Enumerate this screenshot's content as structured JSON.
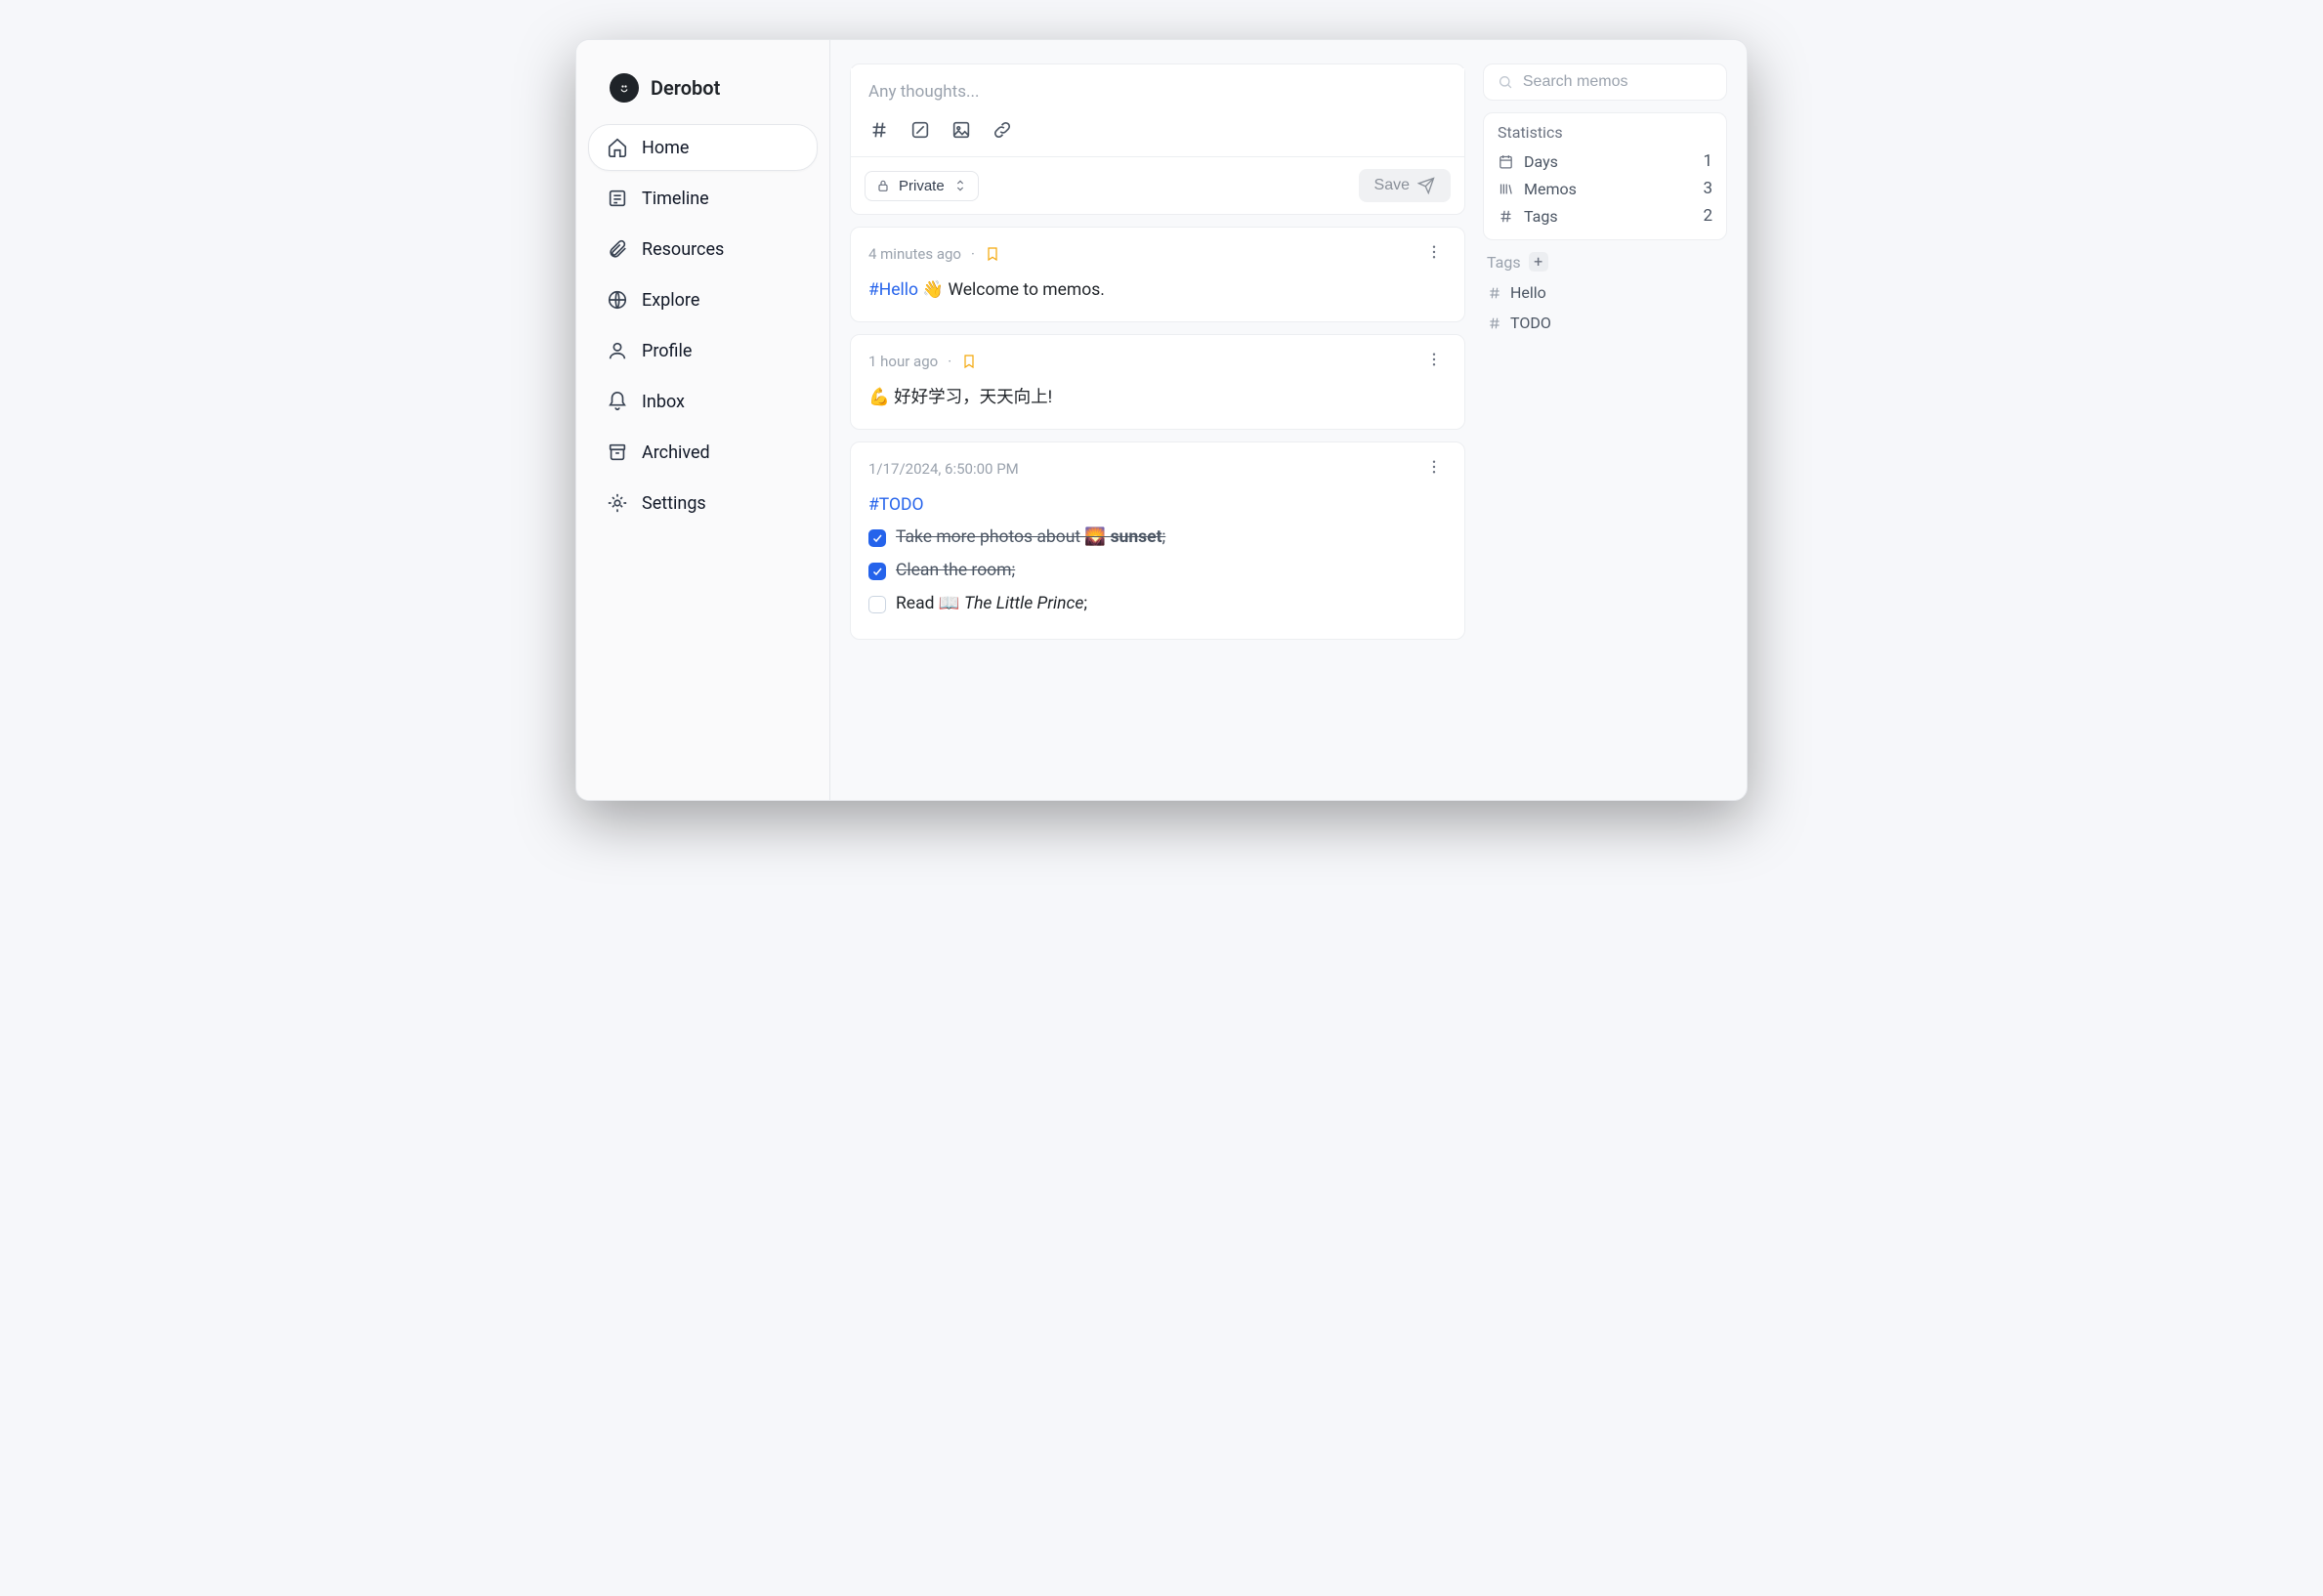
{
  "brand": {
    "name": "Derobot"
  },
  "nav": {
    "items": [
      {
        "label": "Home",
        "icon": "home-icon",
        "active": true
      },
      {
        "label": "Timeline",
        "icon": "timeline-icon",
        "active": false
      },
      {
        "label": "Resources",
        "icon": "paperclip-icon",
        "active": false
      },
      {
        "label": "Explore",
        "icon": "globe-icon",
        "active": false
      },
      {
        "label": "Profile",
        "icon": "user-icon",
        "active": false
      },
      {
        "label": "Inbox",
        "icon": "bell-icon",
        "active": false
      },
      {
        "label": "Archived",
        "icon": "archive-icon",
        "active": false
      },
      {
        "label": "Settings",
        "icon": "gear-icon",
        "active": false
      }
    ]
  },
  "composer": {
    "placeholder": "Any thoughts...",
    "visibility_label": "Private",
    "save_label": "Save"
  },
  "memos": [
    {
      "time": "4 minutes ago",
      "bookmarked": true,
      "content": {
        "tag": "#Hello",
        "rest": " 👋 Welcome to memos."
      }
    },
    {
      "time": "1 hour ago",
      "bookmarked": true,
      "content": {
        "text": "💪 好好学习，天天向上!"
      }
    },
    {
      "time": "1/17/2024, 6:50:00 PM",
      "bookmarked": false,
      "content": {
        "tag": "#TODO",
        "todos": [
          {
            "done": true,
            "prefix": "Take more photos about 🌄 ",
            "bold": "sunset",
            "suffix": ";"
          },
          {
            "done": true,
            "prefix": "Clean the room;",
            "bold": "",
            "suffix": ""
          },
          {
            "done": false,
            "prefix": "Read 📖 ",
            "italic": "The Little Prince",
            "suffix": ";"
          }
        ]
      }
    }
  ],
  "search": {
    "placeholder": "Search memos"
  },
  "stats": {
    "title": "Statistics",
    "rows": [
      {
        "label": "Days",
        "value": "1"
      },
      {
        "label": "Memos",
        "value": "3"
      },
      {
        "label": "Tags",
        "value": "2"
      }
    ]
  },
  "tags": {
    "title": "Tags",
    "items": [
      {
        "label": "Hello"
      },
      {
        "label": "TODO"
      }
    ]
  }
}
